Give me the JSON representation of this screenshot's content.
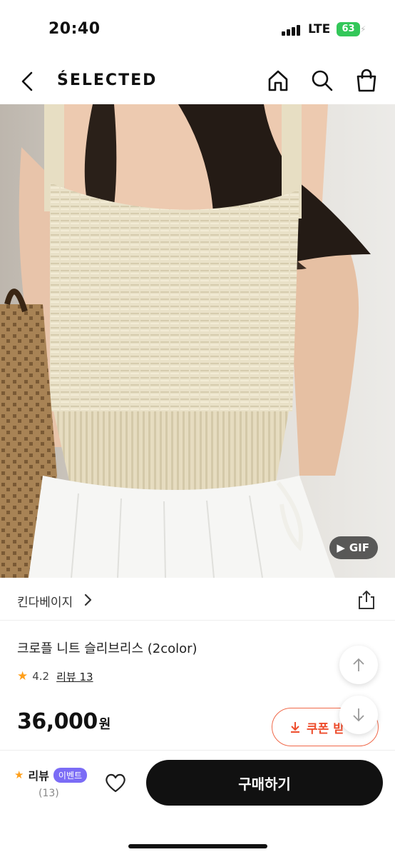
{
  "status_bar": {
    "time": "20:40",
    "network": "LTE",
    "battery": "63"
  },
  "header": {
    "brand": "ŚELECTED",
    "icons": [
      "back-icon",
      "home-icon",
      "search-icon",
      "shopping-bag-icon"
    ]
  },
  "product_image": {
    "badge": "GIF"
  },
  "store": {
    "name": "킨다베이지"
  },
  "product": {
    "title": "크로플 니트 슬리브리스 (2color)",
    "rating": "4.2",
    "review_link": "리뷰 13",
    "price": "36,000",
    "currency": "원"
  },
  "coupon": {
    "label": "쿠폰 받"
  },
  "bottom_bar": {
    "review_label": "리뷰",
    "event_badge": "이벤트",
    "review_count": "(13)",
    "buy_label": "구매하기"
  },
  "colors": {
    "accent_orange": "#ff9f1a",
    "coupon_red": "#ee4d2d",
    "event_purple": "#7b6cf6",
    "buy_button": "#111111",
    "battery_green": "#33c759"
  }
}
